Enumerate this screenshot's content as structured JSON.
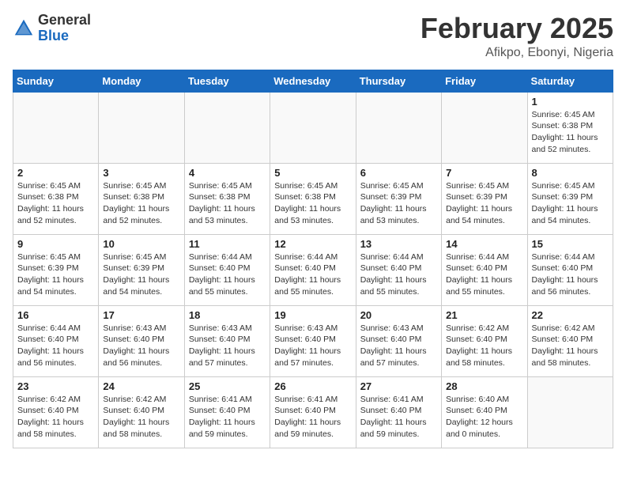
{
  "header": {
    "logo_general": "General",
    "logo_blue": "Blue",
    "month": "February 2025",
    "location": "Afikpo, Ebonyi, Nigeria"
  },
  "weekdays": [
    "Sunday",
    "Monday",
    "Tuesday",
    "Wednesday",
    "Thursday",
    "Friday",
    "Saturday"
  ],
  "weeks": [
    [
      {
        "day": "",
        "info": ""
      },
      {
        "day": "",
        "info": ""
      },
      {
        "day": "",
        "info": ""
      },
      {
        "day": "",
        "info": ""
      },
      {
        "day": "",
        "info": ""
      },
      {
        "day": "",
        "info": ""
      },
      {
        "day": "1",
        "info": "Sunrise: 6:45 AM\nSunset: 6:38 PM\nDaylight: 11 hours\nand 52 minutes."
      }
    ],
    [
      {
        "day": "2",
        "info": "Sunrise: 6:45 AM\nSunset: 6:38 PM\nDaylight: 11 hours\nand 52 minutes."
      },
      {
        "day": "3",
        "info": "Sunrise: 6:45 AM\nSunset: 6:38 PM\nDaylight: 11 hours\nand 52 minutes."
      },
      {
        "day": "4",
        "info": "Sunrise: 6:45 AM\nSunset: 6:38 PM\nDaylight: 11 hours\nand 53 minutes."
      },
      {
        "day": "5",
        "info": "Sunrise: 6:45 AM\nSunset: 6:38 PM\nDaylight: 11 hours\nand 53 minutes."
      },
      {
        "day": "6",
        "info": "Sunrise: 6:45 AM\nSunset: 6:39 PM\nDaylight: 11 hours\nand 53 minutes."
      },
      {
        "day": "7",
        "info": "Sunrise: 6:45 AM\nSunset: 6:39 PM\nDaylight: 11 hours\nand 54 minutes."
      },
      {
        "day": "8",
        "info": "Sunrise: 6:45 AM\nSunset: 6:39 PM\nDaylight: 11 hours\nand 54 minutes."
      }
    ],
    [
      {
        "day": "9",
        "info": "Sunrise: 6:45 AM\nSunset: 6:39 PM\nDaylight: 11 hours\nand 54 minutes."
      },
      {
        "day": "10",
        "info": "Sunrise: 6:45 AM\nSunset: 6:39 PM\nDaylight: 11 hours\nand 54 minutes."
      },
      {
        "day": "11",
        "info": "Sunrise: 6:44 AM\nSunset: 6:40 PM\nDaylight: 11 hours\nand 55 minutes."
      },
      {
        "day": "12",
        "info": "Sunrise: 6:44 AM\nSunset: 6:40 PM\nDaylight: 11 hours\nand 55 minutes."
      },
      {
        "day": "13",
        "info": "Sunrise: 6:44 AM\nSunset: 6:40 PM\nDaylight: 11 hours\nand 55 minutes."
      },
      {
        "day": "14",
        "info": "Sunrise: 6:44 AM\nSunset: 6:40 PM\nDaylight: 11 hours\nand 55 minutes."
      },
      {
        "day": "15",
        "info": "Sunrise: 6:44 AM\nSunset: 6:40 PM\nDaylight: 11 hours\nand 56 minutes."
      }
    ],
    [
      {
        "day": "16",
        "info": "Sunrise: 6:44 AM\nSunset: 6:40 PM\nDaylight: 11 hours\nand 56 minutes."
      },
      {
        "day": "17",
        "info": "Sunrise: 6:43 AM\nSunset: 6:40 PM\nDaylight: 11 hours\nand 56 minutes."
      },
      {
        "day": "18",
        "info": "Sunrise: 6:43 AM\nSunset: 6:40 PM\nDaylight: 11 hours\nand 57 minutes."
      },
      {
        "day": "19",
        "info": "Sunrise: 6:43 AM\nSunset: 6:40 PM\nDaylight: 11 hours\nand 57 minutes."
      },
      {
        "day": "20",
        "info": "Sunrise: 6:43 AM\nSunset: 6:40 PM\nDaylight: 11 hours\nand 57 minutes."
      },
      {
        "day": "21",
        "info": "Sunrise: 6:42 AM\nSunset: 6:40 PM\nDaylight: 11 hours\nand 58 minutes."
      },
      {
        "day": "22",
        "info": "Sunrise: 6:42 AM\nSunset: 6:40 PM\nDaylight: 11 hours\nand 58 minutes."
      }
    ],
    [
      {
        "day": "23",
        "info": "Sunrise: 6:42 AM\nSunset: 6:40 PM\nDaylight: 11 hours\nand 58 minutes."
      },
      {
        "day": "24",
        "info": "Sunrise: 6:42 AM\nSunset: 6:40 PM\nDaylight: 11 hours\nand 58 minutes."
      },
      {
        "day": "25",
        "info": "Sunrise: 6:41 AM\nSunset: 6:40 PM\nDaylight: 11 hours\nand 59 minutes."
      },
      {
        "day": "26",
        "info": "Sunrise: 6:41 AM\nSunset: 6:40 PM\nDaylight: 11 hours\nand 59 minutes."
      },
      {
        "day": "27",
        "info": "Sunrise: 6:41 AM\nSunset: 6:40 PM\nDaylight: 11 hours\nand 59 minutes."
      },
      {
        "day": "28",
        "info": "Sunrise: 6:40 AM\nSunset: 6:40 PM\nDaylight: 12 hours\nand 0 minutes."
      },
      {
        "day": "",
        "info": ""
      }
    ]
  ]
}
